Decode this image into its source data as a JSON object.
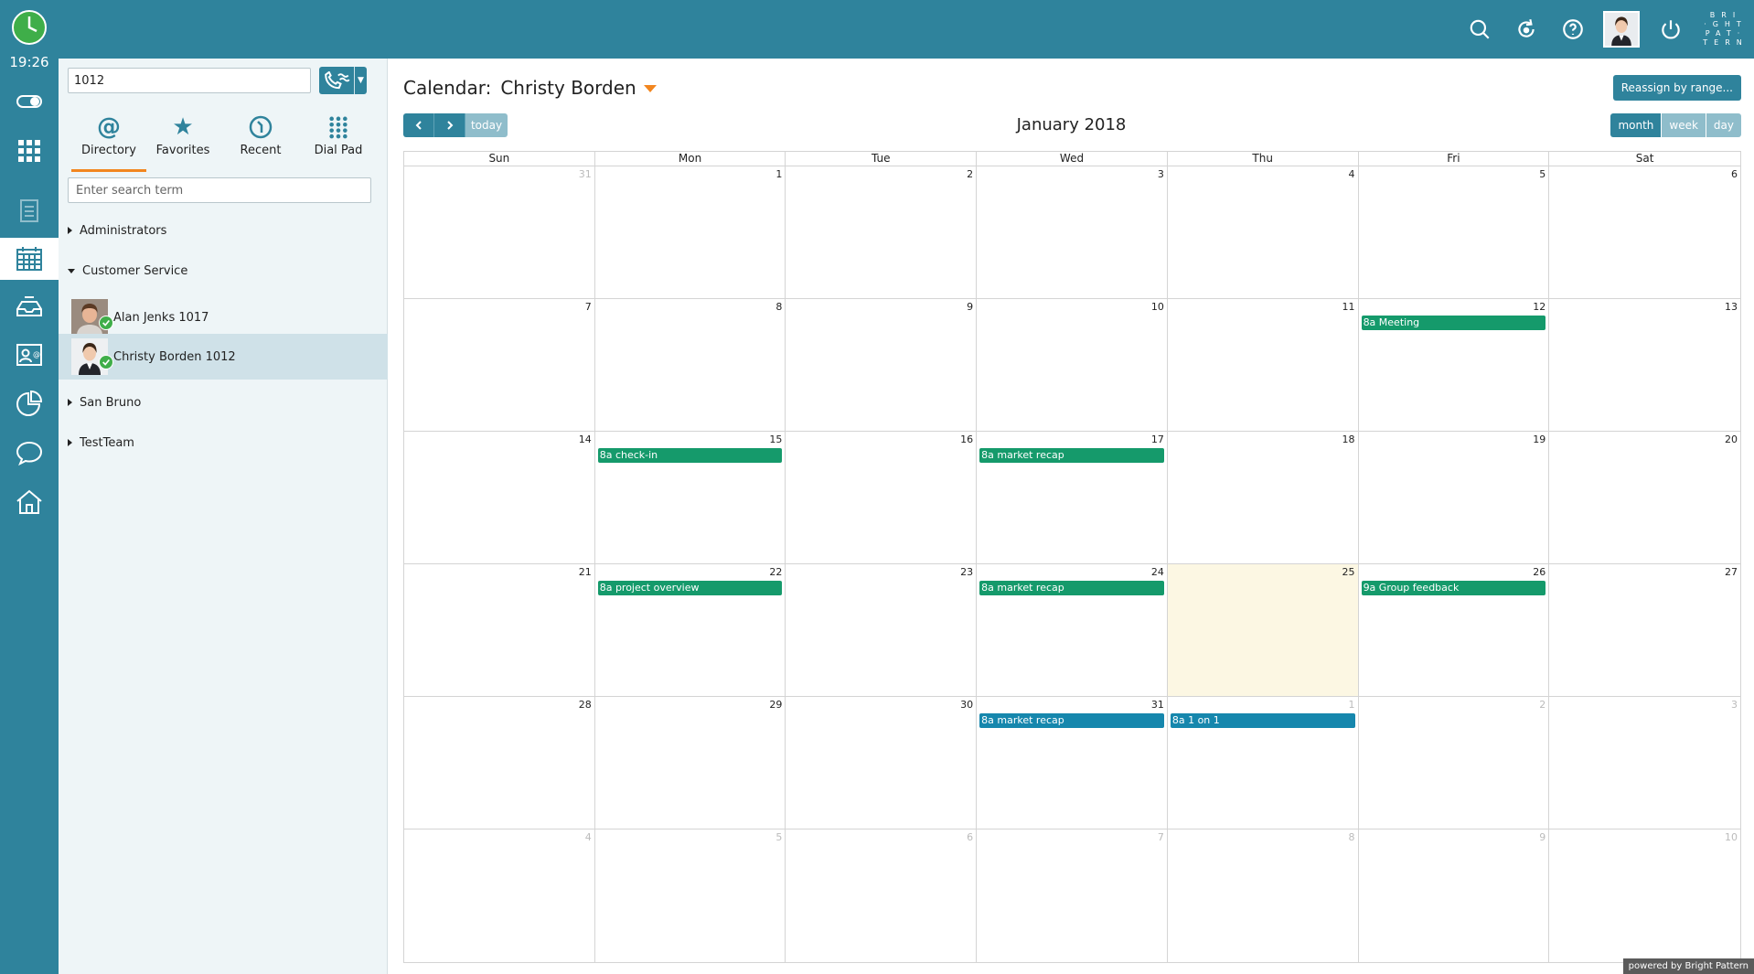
{
  "rail": {
    "time": "19:26",
    "items": [
      {
        "icon": "toggle-icon"
      },
      {
        "icon": "apps-grid-icon"
      },
      {
        "icon": "documents-icon"
      },
      {
        "icon": "calendar-icon"
      },
      {
        "icon": "inbox-tray-icon"
      },
      {
        "icon": "contacts-icon"
      },
      {
        "icon": "reports-icon"
      },
      {
        "icon": "chat-icon"
      },
      {
        "icon": "home-icon"
      }
    ]
  },
  "topbar": {
    "icons": [
      "search-icon",
      "refresh-icon",
      "help-icon",
      "user-avatar",
      "power-icon"
    ],
    "brand_lines": [
      "BRI",
      "·GHT",
      "PAT·",
      "TERN"
    ]
  },
  "dialer": {
    "number": "1012"
  },
  "tabs": [
    {
      "label": "Directory",
      "icon": "at-icon"
    },
    {
      "label": "Favorites",
      "icon": "star-icon"
    },
    {
      "label": "Recent",
      "icon": "recent-icon"
    },
    {
      "label": "Dial Pad",
      "icon": "dialpad-icon"
    }
  ],
  "directory": {
    "search_placeholder": "Enter search term",
    "groups": [
      {
        "label": "Administrators",
        "expanded": false
      },
      {
        "label": "Customer Service",
        "expanded": true
      },
      {
        "label": "San Bruno",
        "expanded": false
      },
      {
        "label": "TestTeam",
        "expanded": false
      }
    ],
    "members": [
      {
        "name": "Alan Jenks 1017",
        "selected": false
      },
      {
        "name": "Christy Borden 1012",
        "selected": true
      }
    ]
  },
  "calendar": {
    "title_prefix": "Calendar:",
    "owner": "Christy Borden",
    "reassign_label": "Reassign by range...",
    "prev": "<",
    "next": ">",
    "today_label": "today",
    "month_label": "January 2018",
    "views": [
      "month",
      "week",
      "day"
    ],
    "active_view": "month",
    "weekdays": [
      "Sun",
      "Mon",
      "Tue",
      "Wed",
      "Thu",
      "Fri",
      "Sat"
    ],
    "today_date": "2018-01-25",
    "weeks": [
      [
        {
          "d": "31",
          "other": true
        },
        {
          "d": "1"
        },
        {
          "d": "2"
        },
        {
          "d": "3"
        },
        {
          "d": "4"
        },
        {
          "d": "5"
        },
        {
          "d": "6"
        }
      ],
      [
        {
          "d": "7"
        },
        {
          "d": "8"
        },
        {
          "d": "9"
        },
        {
          "d": "10"
        },
        {
          "d": "11"
        },
        {
          "d": "12"
        },
        {
          "d": "13"
        }
      ],
      [
        {
          "d": "14"
        },
        {
          "d": "15"
        },
        {
          "d": "16"
        },
        {
          "d": "17"
        },
        {
          "d": "18"
        },
        {
          "d": "19"
        },
        {
          "d": "20"
        }
      ],
      [
        {
          "d": "21"
        },
        {
          "d": "22"
        },
        {
          "d": "23"
        },
        {
          "d": "24"
        },
        {
          "d": "25",
          "today": true
        },
        {
          "d": "26"
        },
        {
          "d": "27"
        }
      ],
      [
        {
          "d": "28"
        },
        {
          "d": "29"
        },
        {
          "d": "30"
        },
        {
          "d": "31"
        },
        {
          "d": "1",
          "other": true
        },
        {
          "d": "2",
          "other": true
        },
        {
          "d": "3",
          "other": true
        }
      ],
      [
        {
          "d": "4",
          "other": true
        },
        {
          "d": "5",
          "other": true
        },
        {
          "d": "6",
          "other": true
        },
        {
          "d": "7",
          "other": true
        },
        {
          "d": "8",
          "other": true
        },
        {
          "d": "9",
          "other": true
        },
        {
          "d": "10",
          "other": true
        }
      ]
    ],
    "events": [
      {
        "week": 1,
        "day": 5,
        "label": "8a Meeting",
        "color": "#159a6b"
      },
      {
        "week": 2,
        "day": 1,
        "label": "8a check-in",
        "color": "#159a6b"
      },
      {
        "week": 2,
        "day": 3,
        "label": "8a market recap",
        "color": "#159a6b"
      },
      {
        "week": 3,
        "day": 1,
        "label": "8a project overview",
        "color": "#159a6b"
      },
      {
        "week": 3,
        "day": 3,
        "label": "8a market recap",
        "color": "#159a6b"
      },
      {
        "week": 3,
        "day": 5,
        "label": "9a Group feedback",
        "color": "#159a6b"
      },
      {
        "week": 4,
        "day": 3,
        "label": "8a market recap",
        "color": "#1687ad"
      },
      {
        "week": 4,
        "day": 4,
        "label": "8a 1 on 1",
        "color": "#1687ad"
      }
    ]
  },
  "footer": {
    "powered": "powered by Bright Pattern"
  },
  "colors": {
    "brand": "#2f839c",
    "accent": "#f2861f",
    "event_green": "#159a6b",
    "event_blue": "#1687ad",
    "today_bg": "#fcf7e3"
  }
}
